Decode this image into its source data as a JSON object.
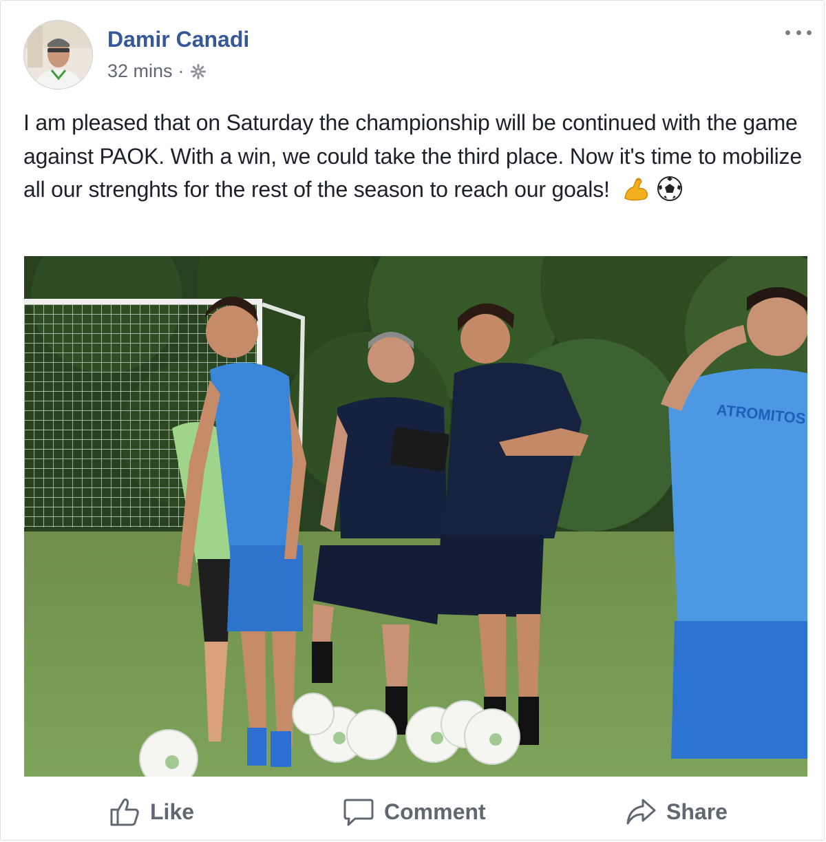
{
  "post": {
    "author": "Damir Canadi",
    "time": "32 mins",
    "separator": "·",
    "privacy_icon": "gear-icon",
    "more_icon": "more-options-icon",
    "text": "I am pleased that on Saturday the championship will be continued with the game against PAOK. With a win, we could take the third place. Now it's time to mobilize all our strenghts for the rest of the season to reach our goals!",
    "emojis": [
      "flexed-biceps",
      "soccer-ball"
    ],
    "photo": {
      "description_icon": "training-photo",
      "shirt_text": "ATROMITOS"
    }
  },
  "actions": [
    {
      "label": "Like",
      "icon": "thumbs-up-icon"
    },
    {
      "label": "Comment",
      "icon": "comment-bubble-icon"
    },
    {
      "label": "Share",
      "icon": "share-arrow-icon"
    }
  ],
  "colors": {
    "author_name": "#365899",
    "meta": "#616770",
    "action_text": "#606770",
    "body_text": "#1d2129"
  }
}
